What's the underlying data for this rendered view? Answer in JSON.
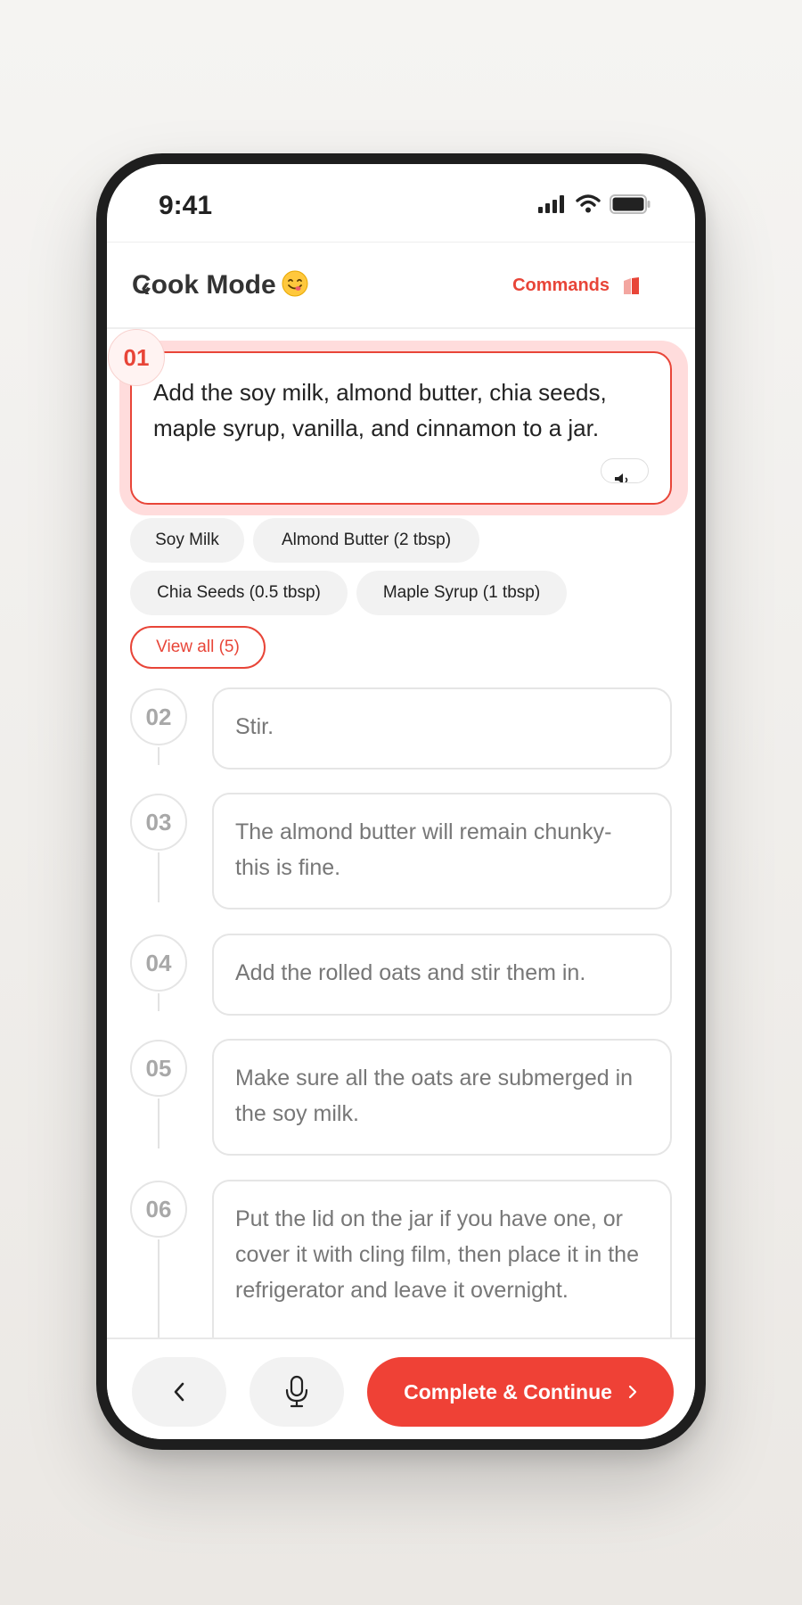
{
  "status_bar": {
    "time": "9:41"
  },
  "header": {
    "title": "Cook Mode",
    "commands_label": "Commands"
  },
  "active_step": {
    "number": "01",
    "text": "Add the soy milk, almond butter, chia seeds, maple syrup, vanilla, and cinnamon to a jar."
  },
  "ingredients": {
    "chips": [
      "Soy Milk",
      "Almond Butter (2 tbsp)",
      "Chia Seeds (0.5 tbsp)",
      "Maple Syrup (1 tbsp)"
    ],
    "view_all_label": "View all (5)"
  },
  "steps": [
    {
      "number": "02",
      "text": "Stir."
    },
    {
      "number": "03",
      "text": "The almond butter will remain chunky- this is fine."
    },
    {
      "number": "04",
      "text": "Add the rolled oats and stir them in."
    },
    {
      "number": "05",
      "text": "Make sure all the oats are submerged in the soy milk."
    },
    {
      "number": "06",
      "text": "Put the lid on the jar if you have one, or cover it with cling film, then place it in the refrigerator and leave it overnight."
    }
  ],
  "bottom_bar": {
    "continue_label": "Complete & Continue"
  },
  "colors": {
    "accent": "#ef4136",
    "accent_soft": "#ffdcdc",
    "muted_text": "#777777"
  }
}
